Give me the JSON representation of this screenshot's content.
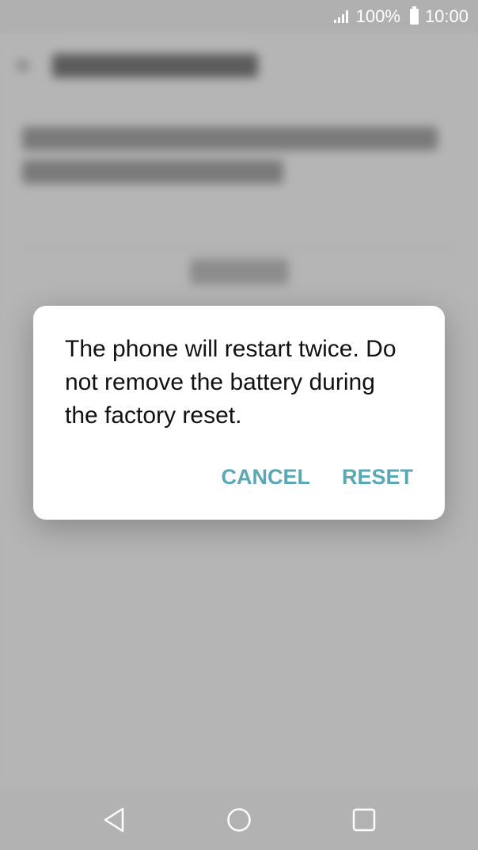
{
  "status_bar": {
    "battery": "100%",
    "time": "10:00",
    "icons": [
      "signal-icon",
      "battery-icon"
    ]
  },
  "dialog": {
    "message": "The phone will restart twice. Do not remove the battery during the factory reset.",
    "cancel_label": "CANCEL",
    "reset_label": "RESET",
    "accent_color": "#5aa8b6"
  },
  "nav_bar": {
    "icons": [
      "back-icon",
      "home-icon",
      "recents-icon"
    ]
  }
}
